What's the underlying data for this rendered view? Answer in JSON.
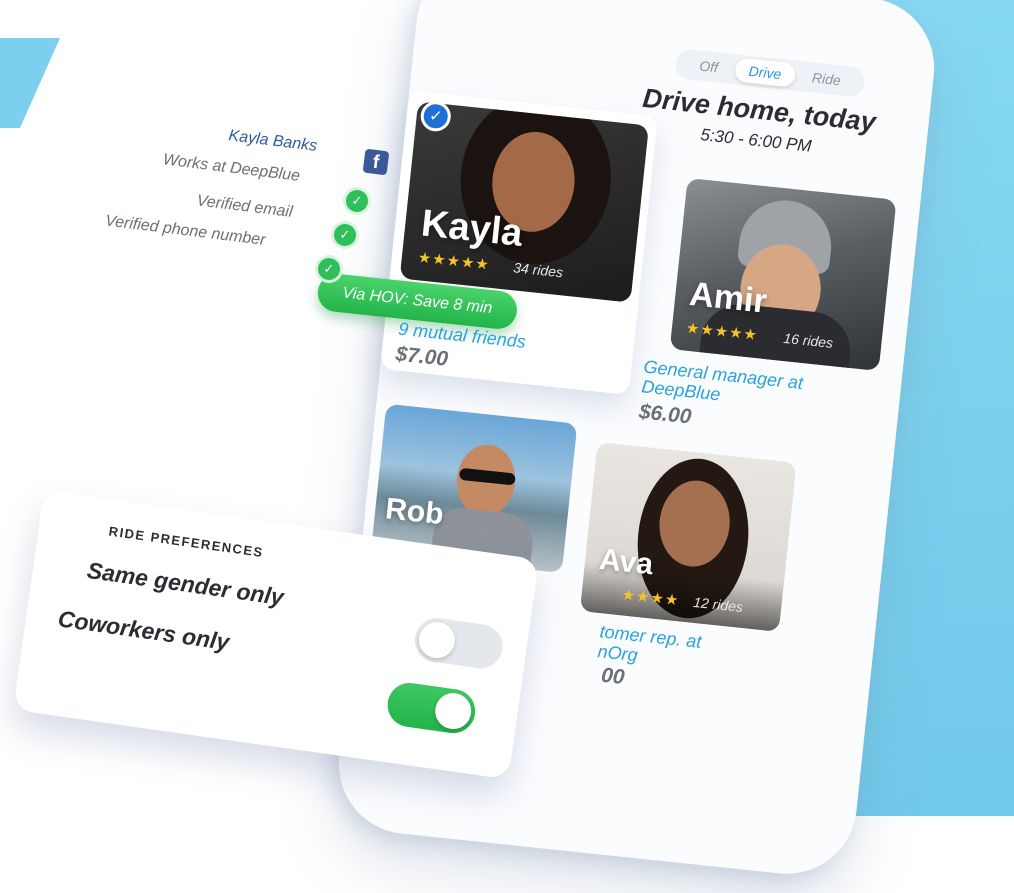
{
  "segment": {
    "options": [
      "Off",
      "Drive",
      "Ride"
    ],
    "selected": "Drive"
  },
  "header": {
    "title": "Drive home, today",
    "time": "5:30 - 6:00 PM"
  },
  "verification": {
    "name": "Kayla Banks",
    "items": [
      "Works at DeepBlue",
      "Verified email",
      "Verified phone number"
    ],
    "social_icon": "facebook-icon",
    "check_icon": "check-circle-icon"
  },
  "drivers": [
    {
      "name": "Kayla",
      "stars": "★★★★★",
      "rides": "34 rides",
      "badge": "Via HOV: Save 8 min",
      "detail": "9 mutual friends",
      "price": "$7.00"
    },
    {
      "name": "Amir",
      "stars": "★★★★★",
      "rides": "16 rides",
      "detail": "General manager at DeepBlue",
      "price": "$6.00"
    },
    {
      "name": "Rob"
    },
    {
      "name": "Ava",
      "stars": "★★★★",
      "rides": "12 rides",
      "detail": "tomer rep. at",
      "detail2": "nOrg",
      "price": "00"
    }
  ],
  "preferences": {
    "header": "RIDE PREFERENCES",
    "options": [
      {
        "label": "Same gender only",
        "enabled": false
      },
      {
        "label": "Coworkers only",
        "enabled": true
      }
    ]
  },
  "colors": {
    "accent": "#28a2e0",
    "success": "#2fbf5b",
    "facebook": "#3b5998",
    "background_blue": "#7ccfee"
  }
}
